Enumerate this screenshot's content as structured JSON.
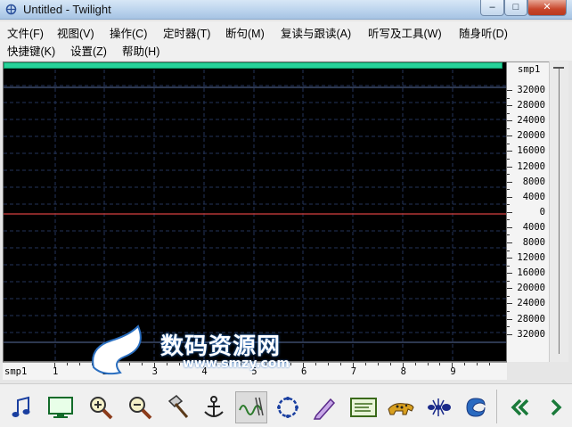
{
  "window": {
    "title": "Untitled - Twilight",
    "min_glyph": "–",
    "max_glyph": "□",
    "close_glyph": "✕"
  },
  "menu": {
    "row1": [
      "文件(F)",
      "视图(V)",
      "操作(C)",
      "定时器(T)",
      "断句(M)",
      "复读与跟读(A)",
      "听写及工具(W)",
      "随身听(D)"
    ],
    "row2": [
      "快捷键(K)",
      "设置(Z)",
      "帮助(H)"
    ]
  },
  "waveform": {
    "y_unit": "smp1",
    "y_labels": [
      "32000",
      "28000",
      "24000",
      "20000",
      "16000",
      "12000",
      "8000",
      "4000",
      "0",
      "4000",
      "8000",
      "12000",
      "16000",
      "20000",
      "24000",
      "28000",
      "32000"
    ],
    "x_unit": "smp1",
    "x_labels": [
      "1",
      "2",
      "3",
      "4",
      "5",
      "6",
      "7",
      "8",
      "9"
    ],
    "colors": {
      "background": "#000000",
      "top_bar": "#27d29a",
      "grid": "#25355a",
      "zero_line": "#b33636",
      "limit_line": "#5a6fa0"
    }
  },
  "toolbar": {
    "buttons": [
      "music-note-icon",
      "monitor-icon",
      "zoom-in-icon",
      "zoom-out-icon",
      "hammer-icon",
      "anchor-icon",
      "waveform-edit-icon",
      "loop-icon",
      "pencil-icon",
      "text-panel-icon",
      "leopard-icon",
      "ant-icon",
      "swirl-icon",
      "double-left-arrow-icon",
      "right-arrow-icon"
    ]
  },
  "watermark": {
    "text": "数码资源网",
    "url": "www.smzy.com"
  }
}
